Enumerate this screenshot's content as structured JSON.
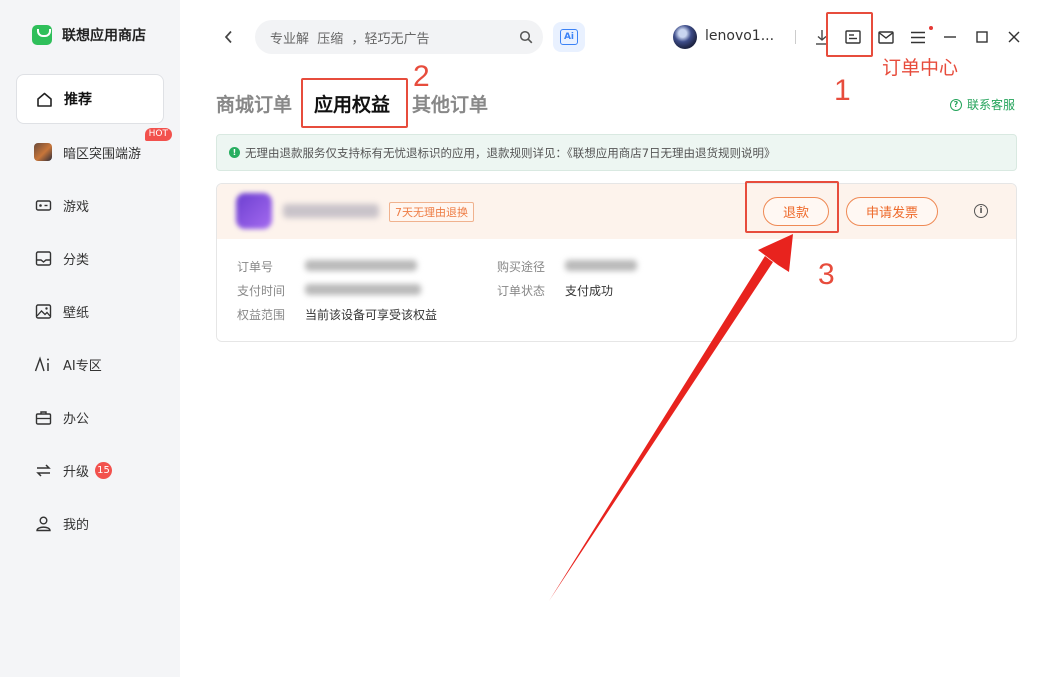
{
  "brand": {
    "name": "联想应用商店"
  },
  "sidebar": {
    "items": [
      {
        "label": "推荐",
        "icon": "home-icon",
        "active": true
      },
      {
        "label": "暗区突围端游",
        "icon": "game-thumbnail",
        "badge": "HOT"
      },
      {
        "label": "游戏",
        "icon": "gamepad-icon"
      },
      {
        "label": "分类",
        "icon": "category-icon"
      },
      {
        "label": "壁纸",
        "icon": "wallpaper-icon"
      },
      {
        "label": "AI专区",
        "icon": "ai-icon"
      },
      {
        "label": "办公",
        "icon": "briefcase-icon"
      },
      {
        "label": "升级",
        "icon": "upgrade-icon",
        "count": "15"
      },
      {
        "label": "我的",
        "icon": "user-icon"
      }
    ]
  },
  "topbar": {
    "search_placeholder": "专业解  压缩  ，轻巧无广告",
    "ai_label": "Ai",
    "username": "lenovo1..."
  },
  "tabs": [
    {
      "label": "商城订单"
    },
    {
      "label": "应用权益",
      "active": true
    },
    {
      "label": "其他订单"
    }
  ],
  "support": {
    "label": "联系客服",
    "icon": "help-circle-icon"
  },
  "notice": {
    "icon": "info-dot-icon",
    "text": "无理由退款服务仅支持标有无忧退标识的应用，退款规则详见：《联想应用商店7日无理由退货规则说明》"
  },
  "order": {
    "tag": "7天无理由退换",
    "refund_label": "退款",
    "invoice_label": "申请发票",
    "fields": {
      "order_no_label": "订单号",
      "pay_time_label": "支付时间",
      "scope_label": "权益范围",
      "scope_value": "当前该设备可享受该权益",
      "channel_label": "购买途径",
      "status_label": "订单状态",
      "status_value": "支付成功"
    }
  },
  "annotations": {
    "step1": "1",
    "step1_text": "订单中心",
    "step2": "2",
    "step3": "3",
    "color": "#e74c3c"
  },
  "colors": {
    "accent_green": "#2fbf5a",
    "accent_orange": "#ee6a2b",
    "badge_red": "#f2514d"
  }
}
